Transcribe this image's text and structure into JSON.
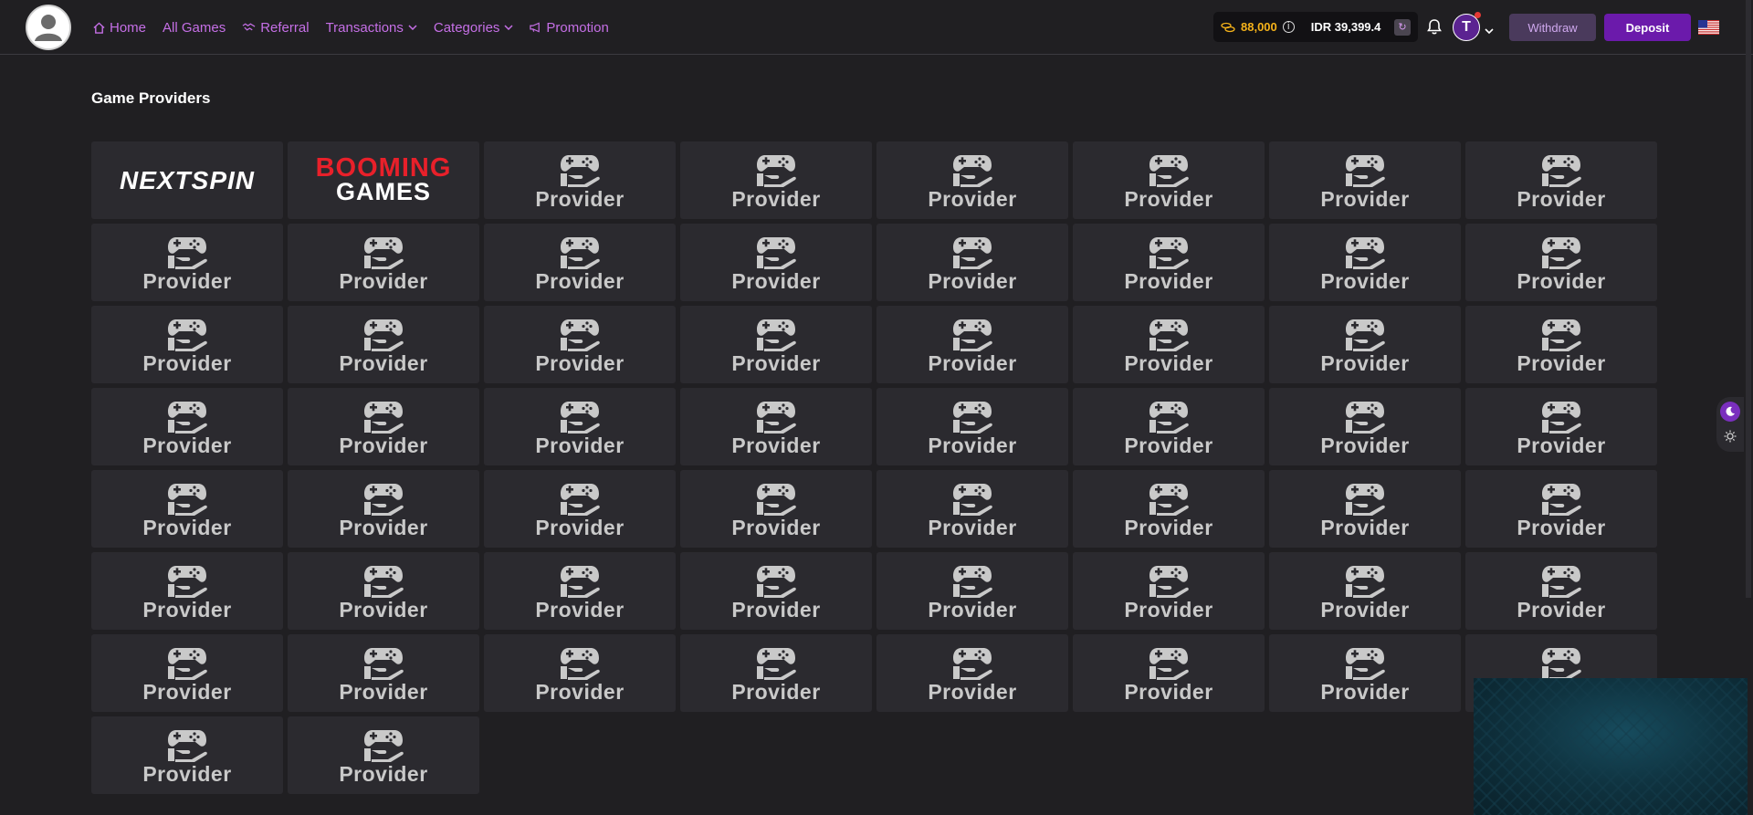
{
  "nav": {
    "home": "Home",
    "all_games": "All Games",
    "referral": "Referral",
    "transactions": "Transactions",
    "categories": "Categories",
    "promotion": "Promotion"
  },
  "wallet": {
    "coins": "88,000",
    "balance": "IDR 39,399.4"
  },
  "user": {
    "initial": "T"
  },
  "buttons": {
    "withdraw": "Withdraw",
    "deposit": "Deposit"
  },
  "page_title": "Game Providers",
  "providers": [
    {
      "type": "logo",
      "name": "NEXTSPIN"
    },
    {
      "type": "logo",
      "name": "BOOMING GAMES"
    },
    {
      "type": "placeholder",
      "label": "Provider"
    },
    {
      "type": "placeholder",
      "label": "Provider"
    },
    {
      "type": "placeholder",
      "label": "Provider"
    },
    {
      "type": "placeholder",
      "label": "Provider"
    },
    {
      "type": "placeholder",
      "label": "Provider"
    },
    {
      "type": "placeholder",
      "label": "Provider"
    },
    {
      "type": "placeholder",
      "label": "Provider"
    },
    {
      "type": "placeholder",
      "label": "Provider"
    },
    {
      "type": "placeholder",
      "label": "Provider"
    },
    {
      "type": "placeholder",
      "label": "Provider"
    },
    {
      "type": "placeholder",
      "label": "Provider"
    },
    {
      "type": "placeholder",
      "label": "Provider"
    },
    {
      "type": "placeholder",
      "label": "Provider"
    },
    {
      "type": "placeholder",
      "label": "Provider"
    },
    {
      "type": "placeholder",
      "label": "Provider"
    },
    {
      "type": "placeholder",
      "label": "Provider"
    },
    {
      "type": "placeholder",
      "label": "Provider"
    },
    {
      "type": "placeholder",
      "label": "Provider"
    },
    {
      "type": "placeholder",
      "label": "Provider"
    },
    {
      "type": "placeholder",
      "label": "Provider"
    },
    {
      "type": "placeholder",
      "label": "Provider"
    },
    {
      "type": "placeholder",
      "label": "Provider"
    },
    {
      "type": "placeholder",
      "label": "Provider"
    },
    {
      "type": "placeholder",
      "label": "Provider"
    },
    {
      "type": "placeholder",
      "label": "Provider"
    },
    {
      "type": "placeholder",
      "label": "Provider"
    },
    {
      "type": "placeholder",
      "label": "Provider"
    },
    {
      "type": "placeholder",
      "label": "Provider"
    },
    {
      "type": "placeholder",
      "label": "Provider"
    },
    {
      "type": "placeholder",
      "label": "Provider"
    },
    {
      "type": "placeholder",
      "label": "Provider"
    },
    {
      "type": "placeholder",
      "label": "Provider"
    },
    {
      "type": "placeholder",
      "label": "Provider"
    },
    {
      "type": "placeholder",
      "label": "Provider"
    },
    {
      "type": "placeholder",
      "label": "Provider"
    },
    {
      "type": "placeholder",
      "label": "Provider"
    },
    {
      "type": "placeholder",
      "label": "Provider"
    },
    {
      "type": "placeholder",
      "label": "Provider"
    },
    {
      "type": "placeholder",
      "label": "Provider"
    },
    {
      "type": "placeholder",
      "label": "Provider"
    },
    {
      "type": "placeholder",
      "label": "Provider"
    },
    {
      "type": "placeholder",
      "label": "Provider"
    },
    {
      "type": "placeholder",
      "label": "Provider"
    },
    {
      "type": "placeholder",
      "label": "Provider"
    },
    {
      "type": "placeholder",
      "label": "Provider"
    },
    {
      "type": "placeholder",
      "label": "Provider"
    },
    {
      "type": "placeholder",
      "label": "Provider"
    },
    {
      "type": "placeholder",
      "label": "Provider"
    },
    {
      "type": "placeholder",
      "label": "Provider"
    },
    {
      "type": "placeholder",
      "label": "Provider"
    },
    {
      "type": "placeholder",
      "label": "Provider"
    },
    {
      "type": "placeholder",
      "label": "Provider"
    },
    {
      "type": "placeholder",
      "label": "Provider"
    },
    {
      "type": "placeholder",
      "label": "Provider"
    },
    {
      "type": "placeholder",
      "label": "Provider"
    },
    {
      "type": "placeholder",
      "label": "Provider"
    }
  ],
  "colors": {
    "accent": "#c56fe6",
    "deposit": "#6b1aab",
    "coins": "#f4b21a",
    "background": "#201f22",
    "card": "#2b2a2f"
  }
}
